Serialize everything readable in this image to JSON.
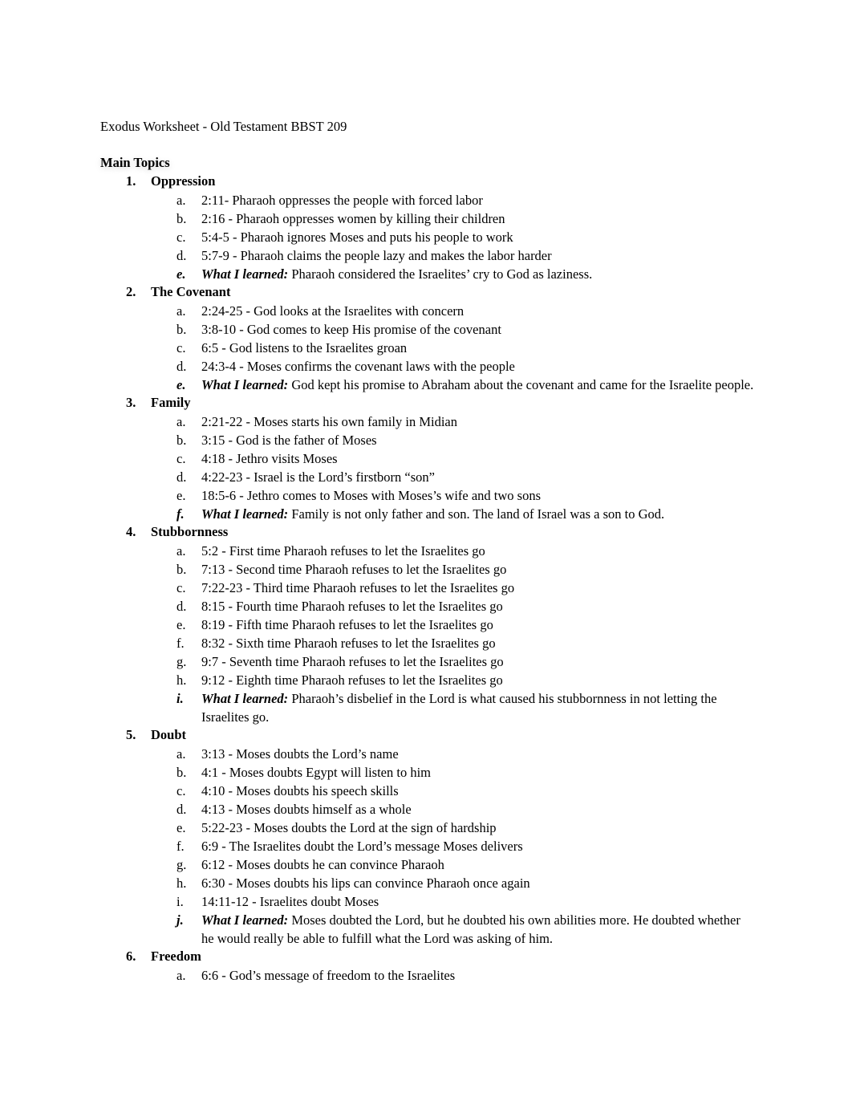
{
  "document": {
    "title": "Exodus Worksheet - Old Testament BBST 209",
    "section_heading": "Main Topics",
    "learned_label": "What I learned:",
    "topics": [
      {
        "number": "1.",
        "label": "Oppression",
        "items": [
          {
            "letter": "a.",
            "text": "2:11- Pharaoh oppresses the people with forced labor"
          },
          {
            "letter": "b.",
            "text": "2:16 - Pharaoh oppresses women by killing their children"
          },
          {
            "letter": "c.",
            "text": "5:4-5 - Pharaoh ignores Moses and puts his people to work"
          },
          {
            "letter": "d.",
            "text": "5:7-9 - Pharaoh claims the people lazy and makes the labor harder"
          }
        ],
        "learned": {
          "letter": "e.",
          "text": "Pharaoh considered the Israelites’ cry to God as laziness."
        }
      },
      {
        "number": "2.",
        "label": "The Covenant",
        "items": [
          {
            "letter": "a.",
            "text": "2:24-25 - God looks at the Israelites with concern"
          },
          {
            "letter": "b.",
            "text": "3:8-10 - God comes to keep His promise of the covenant"
          },
          {
            "letter": "c.",
            "text": "6:5 - God listens to the Israelites groan"
          },
          {
            "letter": "d.",
            "text": "24:3-4 - Moses confirms the covenant laws with the people"
          }
        ],
        "learned": {
          "letter": "e.",
          "text": "God kept his promise to Abraham about the covenant and came for the Israelite people."
        }
      },
      {
        "number": "3.",
        "label": "Family",
        "items": [
          {
            "letter": "a.",
            "text": "2:21-22 - Moses starts his own family in Midian"
          },
          {
            "letter": "b.",
            "text": "3:15 - God is the father of Moses"
          },
          {
            "letter": "c.",
            "text": "4:18 - Jethro visits Moses"
          },
          {
            "letter": "d.",
            "text": "4:22-23 - Israel is the Lord’s firstborn “son”"
          },
          {
            "letter": "e.",
            "text": "18:5-6 - Jethro comes to Moses with Moses’s wife and two sons"
          }
        ],
        "learned": {
          "letter": "f.",
          "text": "Family is not only father and son. The land of Israel was a son to God."
        }
      },
      {
        "number": "4.",
        "label": "Stubbornness",
        "items": [
          {
            "letter": "a.",
            "text": "5:2 - First time Pharaoh refuses to let the Israelites go"
          },
          {
            "letter": "b.",
            "text": "7:13 - Second time Pharaoh refuses to let the Israelites go"
          },
          {
            "letter": "c.",
            "text": "7:22-23 - Third time Pharaoh refuses to let the Israelites go"
          },
          {
            "letter": "d.",
            "text": "8:15 - Fourth time Pharaoh refuses to let the Israelites go"
          },
          {
            "letter": "e.",
            "text": "8:19 - Fifth time Pharaoh refuses to let the Israelites go"
          },
          {
            "letter": "f.",
            "text": "8:32 - Sixth time Pharaoh refuses to let the Israelites go"
          },
          {
            "letter": "g.",
            "text": "9:7 - Seventh time Pharaoh refuses to let the Israelites go"
          },
          {
            "letter": "h.",
            "text": "9:12 - Eighth time Pharaoh refuses to let the Israelites go"
          }
        ],
        "learned": {
          "letter": "i.",
          "text": "Pharaoh’s disbelief in the Lord is what caused his stubbornness in not letting the Israelites go."
        }
      },
      {
        "number": "5.",
        "label": "Doubt",
        "items": [
          {
            "letter": "a.",
            "text": "3:13 - Moses doubts the Lord’s name"
          },
          {
            "letter": "b.",
            "text": "4:1 - Moses doubts Egypt will listen to him"
          },
          {
            "letter": "c.",
            "text": "4:10 - Moses doubts his speech skills"
          },
          {
            "letter": "d.",
            "text": "4:13 - Moses doubts himself as a whole"
          },
          {
            "letter": "e.",
            "text": "5:22-23 - Moses doubts the Lord at the sign of hardship"
          },
          {
            "letter": "f.",
            "text": "6:9 - The Israelites doubt the Lord’s message Moses delivers"
          },
          {
            "letter": "g.",
            "text": "6:12 - Moses doubts he can convince Pharaoh"
          },
          {
            "letter": "h.",
            "text": "6:30 - Moses doubts his lips can convince Pharaoh once again"
          },
          {
            "letter": "i.",
            "text": "14:11-12 - Israelites doubt Moses"
          }
        ],
        "learned": {
          "letter": "j.",
          "text": "Moses doubted the Lord, but he doubted his own abilities more. He doubted whether he would really be able to fulfill what the Lord was asking of him."
        }
      },
      {
        "number": "6.",
        "label": "Freedom",
        "items": [
          {
            "letter": "a.",
            "text": "6:6 - God’s message of freedom to the Israelites"
          }
        ],
        "learned": null
      }
    ]
  }
}
